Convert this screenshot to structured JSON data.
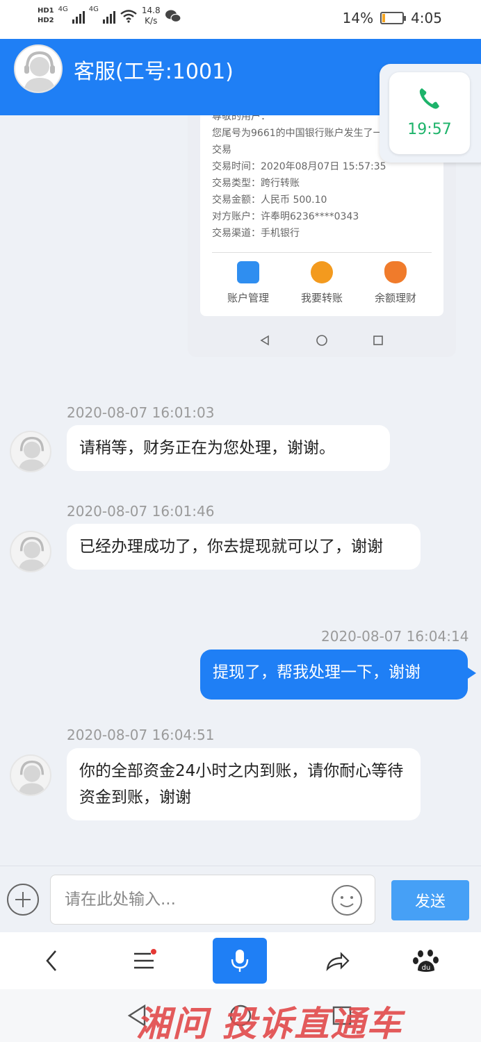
{
  "status_bar": {
    "hd1": "HD1",
    "hd2": "HD2",
    "net1": "4G",
    "net2": "4G",
    "speed_value": "14.8",
    "speed_unit": "K/s",
    "battery_text": "14%",
    "battery_level": 0.14,
    "time": "4:05"
  },
  "header": {
    "title": "客服(工号:1001)"
  },
  "call_widget": {
    "time": "19:57",
    "color": "#1db36a"
  },
  "screenshot": {
    "lines": [
      "尊敬的用户：",
      "您尾号为9661的中国银行账户发生了一",
      "交易",
      "交易时间：2020年08月07日 15:57:35",
      "交易类型：跨行转账",
      "交易金额：人民币 500.10",
      "对方账户：许奉明6236****0343",
      "交易渠道：手机银行"
    ],
    "actions": [
      "账户管理",
      "我要转账",
      "余额理财"
    ]
  },
  "messages": [
    {
      "direction": "in",
      "time": "2020-08-07 16:01:03",
      "text": "请稍等，财务正在为您处理，谢谢。"
    },
    {
      "direction": "in",
      "time": "2020-08-07 16:01:46",
      "text": "已经办理成功了，你去提现就可以了，谢谢"
    },
    {
      "direction": "out",
      "time": "2020-08-07 16:04:14",
      "text": "提现了，帮我处理一下，谢谢"
    },
    {
      "direction": "in",
      "time": "2020-08-07 16:04:51",
      "text": "你的全部资金24小时之内到账，请你耐心等待资金到账，谢谢"
    }
  ],
  "input": {
    "placeholder": "请在此处输入...",
    "send_label": "发送"
  },
  "watermark": "湘问 投诉直通车",
  "colors": {
    "accent": "#1f7ff5",
    "send": "#46a0f6"
  }
}
